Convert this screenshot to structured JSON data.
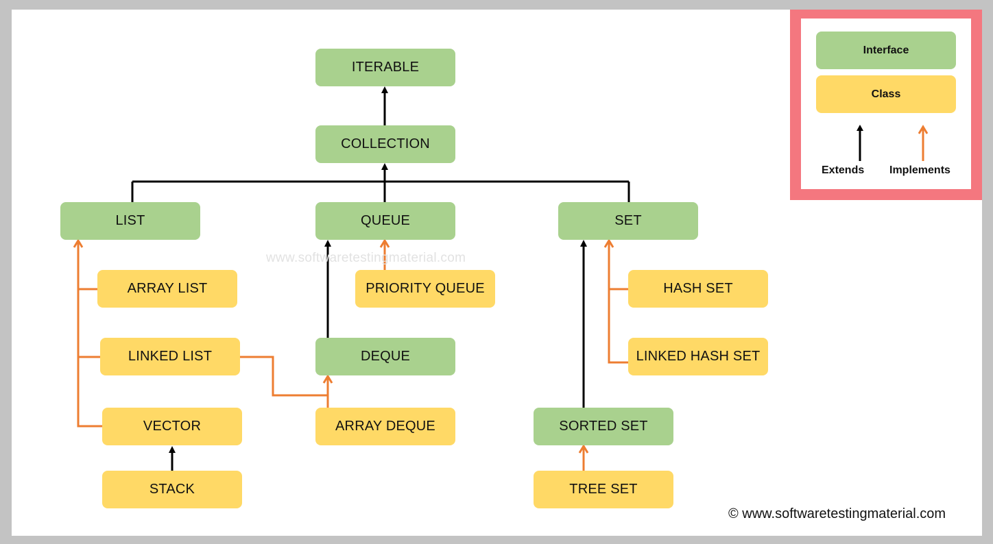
{
  "colors": {
    "interface": "#a9d18e",
    "class": "#ffd966",
    "extends_arrow": "#000000",
    "implements_arrow": "#ed7d31",
    "legend_border": "#f4777f",
    "background": "#c3c3c3"
  },
  "nodes": {
    "iterable": {
      "label": "ITERABLE",
      "kind": "interface"
    },
    "collection": {
      "label": "COLLECTION",
      "kind": "interface"
    },
    "list": {
      "label": "LIST",
      "kind": "interface"
    },
    "queue": {
      "label": "QUEUE",
      "kind": "interface"
    },
    "set": {
      "label": "SET",
      "kind": "interface"
    },
    "array_list": {
      "label": "ARRAY LIST",
      "kind": "class"
    },
    "linked_list": {
      "label": "LINKED LIST",
      "kind": "class"
    },
    "vector": {
      "label": "VECTOR",
      "kind": "class"
    },
    "stack": {
      "label": "STACK",
      "kind": "class"
    },
    "priority_queue": {
      "label": "PRIORITY QUEUE",
      "kind": "class"
    },
    "deque": {
      "label": "DEQUE",
      "kind": "interface"
    },
    "array_deque": {
      "label": "ARRAY DEQUE",
      "kind": "class"
    },
    "hash_set": {
      "label": "HASH SET",
      "kind": "class"
    },
    "linked_hash_set": {
      "label": "LINKED HASH SET",
      "kind": "class"
    },
    "sorted_set": {
      "label": "SORTED SET",
      "kind": "interface"
    },
    "tree_set": {
      "label": "TREE SET",
      "kind": "class"
    }
  },
  "edges": [
    {
      "from": "collection",
      "to": "iterable",
      "type": "extends"
    },
    {
      "from": "list",
      "to": "collection",
      "type": "extends"
    },
    {
      "from": "queue",
      "to": "collection",
      "type": "extends"
    },
    {
      "from": "set",
      "to": "collection",
      "type": "extends"
    },
    {
      "from": "array_list",
      "to": "list",
      "type": "implements"
    },
    {
      "from": "linked_list",
      "to": "list",
      "type": "implements"
    },
    {
      "from": "vector",
      "to": "list",
      "type": "implements"
    },
    {
      "from": "stack",
      "to": "vector",
      "type": "extends"
    },
    {
      "from": "priority_queue",
      "to": "queue",
      "type": "implements"
    },
    {
      "from": "deque",
      "to": "queue",
      "type": "extends"
    },
    {
      "from": "linked_list",
      "to": "deque",
      "type": "implements"
    },
    {
      "from": "array_deque",
      "to": "deque",
      "type": "implements"
    },
    {
      "from": "hash_set",
      "to": "set",
      "type": "implements"
    },
    {
      "from": "linked_hash_set",
      "to": "set",
      "type": "implements"
    },
    {
      "from": "sorted_set",
      "to": "set",
      "type": "extends"
    },
    {
      "from": "tree_set",
      "to": "sorted_set",
      "type": "implements"
    }
  ],
  "legend": {
    "interface_label": "Interface",
    "class_label": "Class",
    "extends_label": "Extends",
    "implements_label": "Implements"
  },
  "watermark": "www.softwaretestingmaterial.com",
  "copyright": "© www.softwaretestingmaterial.com"
}
